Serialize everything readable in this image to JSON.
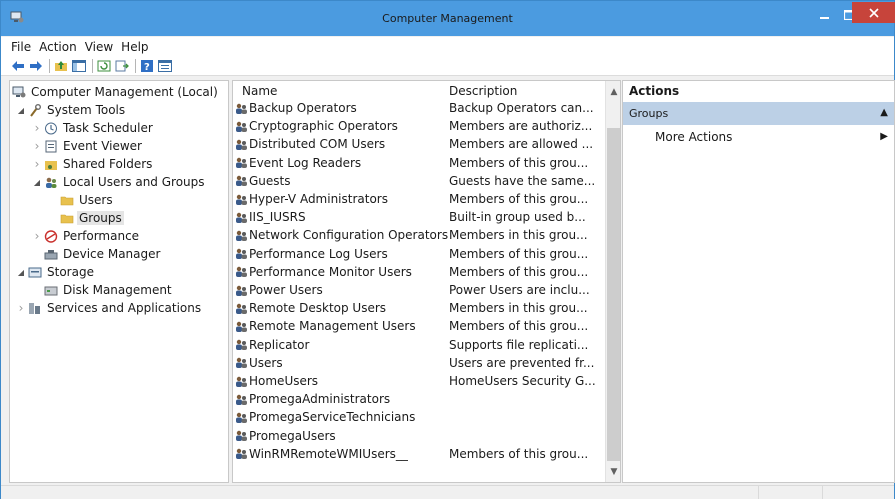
{
  "window": {
    "title": "Computer Management",
    "controls": [
      "minimize",
      "maximize",
      "close"
    ]
  },
  "menu": [
    "File",
    "Action",
    "View",
    "Help"
  ],
  "toolbar": [
    "back-icon",
    "forward-icon",
    "up-folder-icon",
    "show-hide-tree-icon",
    "refresh-icon",
    "export-list-icon",
    "help-icon",
    "properties-icon"
  ],
  "tree": [
    {
      "label": "Computer Management (Local)",
      "icon": "computer-management-icon",
      "indent": 0,
      "toggle": ""
    },
    {
      "label": "System Tools",
      "icon": "system-tools-icon",
      "indent": 1,
      "toggle": "open"
    },
    {
      "label": "Task Scheduler",
      "icon": "task-scheduler-icon",
      "indent": 2,
      "toggle": "closed"
    },
    {
      "label": "Event Viewer",
      "icon": "event-viewer-icon",
      "indent": 2,
      "toggle": "closed"
    },
    {
      "label": "Shared Folders",
      "icon": "shared-folders-icon",
      "indent": 2,
      "toggle": "closed"
    },
    {
      "label": "Local Users and Groups",
      "icon": "users-groups-icon",
      "indent": 2,
      "toggle": "open"
    },
    {
      "label": "Users",
      "icon": "folder-icon",
      "indent": 3,
      "toggle": ""
    },
    {
      "label": "Groups",
      "icon": "folder-icon",
      "indent": 3,
      "toggle": "",
      "selected": true
    },
    {
      "label": "Performance",
      "icon": "performance-icon",
      "indent": 2,
      "toggle": "closed"
    },
    {
      "label": "Device Manager",
      "icon": "device-manager-icon",
      "indent": 2,
      "toggle": ""
    },
    {
      "label": "Storage",
      "icon": "storage-icon",
      "indent": 1,
      "toggle": "open"
    },
    {
      "label": "Disk Management",
      "icon": "disk-management-icon",
      "indent": 2,
      "toggle": ""
    },
    {
      "label": "Services and Applications",
      "icon": "services-icon",
      "indent": 1,
      "toggle": "closed"
    }
  ],
  "list": {
    "columns": [
      "Name",
      "Description"
    ],
    "rows": [
      {
        "name": "Backup Operators",
        "description": "Backup Operators can..."
      },
      {
        "name": "Cryptographic Operators",
        "description": "Members are authoriz..."
      },
      {
        "name": "Distributed COM Users",
        "description": "Members are allowed ..."
      },
      {
        "name": "Event Log Readers",
        "description": "Members of this grou..."
      },
      {
        "name": "Guests",
        "description": "Guests have the same..."
      },
      {
        "name": "Hyper-V Administrators",
        "description": "Members of this grou..."
      },
      {
        "name": "IIS_IUSRS",
        "description": "Built-in group used b..."
      },
      {
        "name": "Network Configuration Operators",
        "description": "Members in this grou..."
      },
      {
        "name": "Performance Log Users",
        "description": "Members of this grou..."
      },
      {
        "name": "Performance Monitor Users",
        "description": "Members of this grou..."
      },
      {
        "name": "Power Users",
        "description": "Power Users are inclu..."
      },
      {
        "name": "Remote Desktop Users",
        "description": "Members in this grou..."
      },
      {
        "name": "Remote Management Users",
        "description": "Members of this grou..."
      },
      {
        "name": "Replicator",
        "description": "Supports file replicati..."
      },
      {
        "name": "Users",
        "description": "Users are prevented fr..."
      },
      {
        "name": "HomeUsers",
        "description": "HomeUsers Security G..."
      },
      {
        "name": "PromegaAdministrators",
        "description": ""
      },
      {
        "name": "PromegaServiceTechnicians",
        "description": ""
      },
      {
        "name": "PromegaUsers",
        "description": ""
      },
      {
        "name": "WinRMRemoteWMIUsers__",
        "description": "Members of this grou..."
      }
    ]
  },
  "actions": {
    "title": "Actions",
    "section": "Groups",
    "items": [
      "More Actions"
    ]
  },
  "colors": {
    "titlebar": "#4b9be0",
    "close_button": "#c7443b",
    "actions_section": "#bcd0e6"
  }
}
